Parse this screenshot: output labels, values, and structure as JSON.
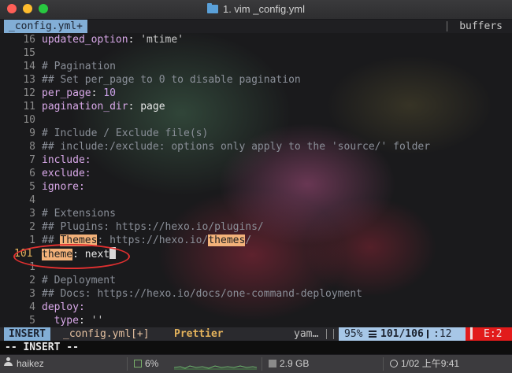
{
  "window": {
    "title": "1. vim _config.yml"
  },
  "tabline": {
    "active_tab": "_config.yml+",
    "buffers_label": "buffers"
  },
  "lines": [
    {
      "num": "16",
      "text": "updated_option: 'mtime'"
    },
    {
      "num": "15",
      "text": ""
    },
    {
      "num": "14",
      "text": "# Pagination"
    },
    {
      "num": "13",
      "text": "## Set per_page to 0 to disable pagination"
    },
    {
      "num": "12",
      "text": "per_page: 10"
    },
    {
      "num": "11",
      "text": "pagination_dir: page"
    },
    {
      "num": "10",
      "text": ""
    },
    {
      "num": "9",
      "text": "# Include / Exclude file(s)"
    },
    {
      "num": "8",
      "text": "## include:/exclude: options only apply to the 'source/' folder"
    },
    {
      "num": "7",
      "text": "include:"
    },
    {
      "num": "6",
      "text": "exclude:"
    },
    {
      "num": "5",
      "text": "ignore:"
    },
    {
      "num": "4",
      "text": ""
    },
    {
      "num": "3",
      "text": "# Extensions"
    },
    {
      "num": "2",
      "text": "## Plugins: https://hexo.io/plugins/"
    },
    {
      "num": "1",
      "text": "## Themes: https://hexo.io/themes/"
    },
    {
      "num": "101",
      "text": "theme: next"
    },
    {
      "num": "1",
      "text": ""
    },
    {
      "num": "2",
      "text": "# Deployment"
    },
    {
      "num": "3",
      "text": "## Docs: https://hexo.io/docs/one-command-deployment"
    },
    {
      "num": "4",
      "text": "deploy:"
    },
    {
      "num": "5",
      "text": "  type: ''"
    }
  ],
  "statusline": {
    "mode": "INSERT",
    "file": "_config.yml[+]",
    "formatter": "Prettier",
    "filetype": "yam…",
    "percent": "95%",
    "line_info": "101/106",
    "column": ":12",
    "errors": "E:2"
  },
  "cmdline": {
    "text": "-- INSERT --"
  },
  "tmux": {
    "user": "haikez",
    "cpu": "6%",
    "memory": "2.9 GB",
    "datetime": "1/02 上午9:41"
  },
  "colors": {
    "accent": "#82aed6",
    "highlight": "#f3b27a",
    "error": "#e21b1b"
  }
}
